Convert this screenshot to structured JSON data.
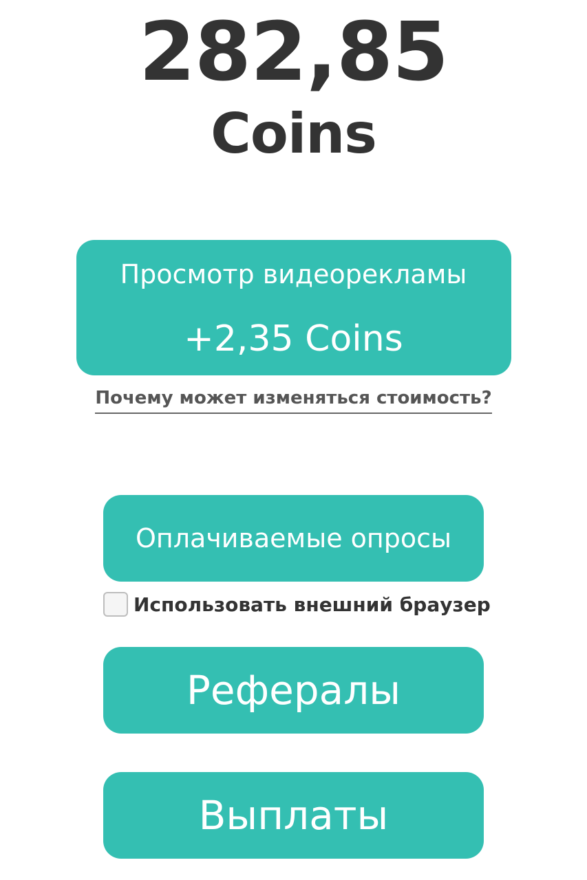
{
  "balance": {
    "amount": "282,85",
    "unit": "Coins"
  },
  "video_ad": {
    "title": "Просмотр видеорекламы",
    "reward": "+2,35 Coins"
  },
  "why_link": "Почему может изменяться стоимость?",
  "surveys": {
    "label": "Оплачиваемые опросы"
  },
  "external_browser": {
    "label": "Использовать внешний браузер",
    "checked": false
  },
  "referrals": {
    "label": "Рефералы"
  },
  "payouts": {
    "label": "Выплаты"
  },
  "colors": {
    "accent": "#34bfb2",
    "text": "#333333",
    "button_text": "#ffffff"
  }
}
